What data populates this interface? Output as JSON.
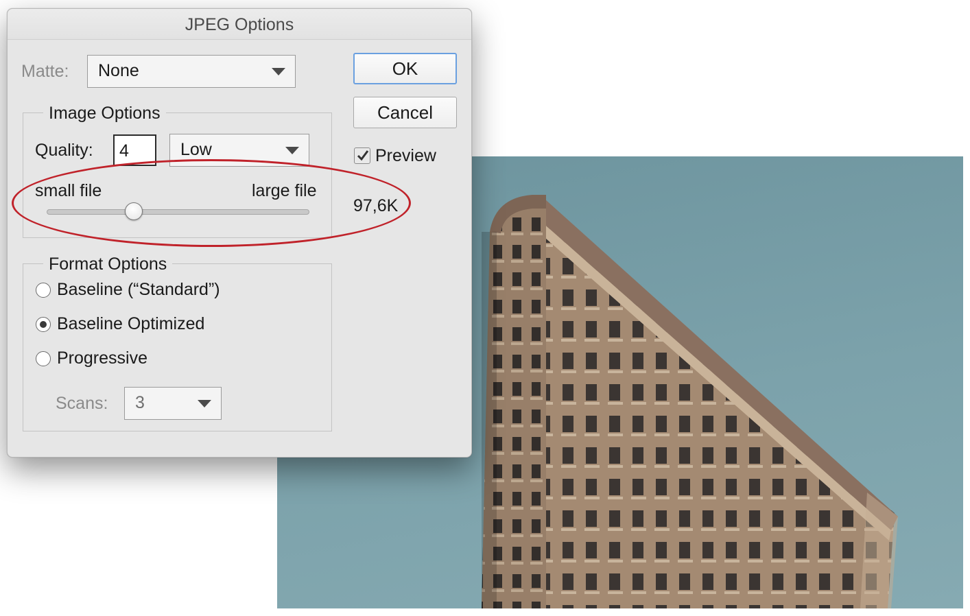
{
  "dialog": {
    "title": "JPEG Options",
    "matte": {
      "label": "Matte:",
      "value": "None"
    },
    "image_options": {
      "legend": "Image Options",
      "quality_label": "Quality:",
      "quality_value": "4",
      "quality_preset": "Low",
      "slider_min_label": "small file",
      "slider_max_label": "large file",
      "slider_level_fraction": 0.33
    },
    "format_options": {
      "legend": "Format Options",
      "options": [
        {
          "label": "Baseline (“Standard”)",
          "selected": false
        },
        {
          "label": "Baseline Optimized",
          "selected": true
        },
        {
          "label": "Progressive",
          "selected": false
        }
      ],
      "scans_label": "Scans:",
      "scans_value": "3"
    },
    "buttons": {
      "ok": "OK",
      "cancel": "Cancel"
    },
    "preview": {
      "label": "Preview",
      "checked": true
    },
    "file_size": "97,6K"
  },
  "colors": {
    "annotation": "#c0222a",
    "default_button_ring": "#6aa0e0",
    "dialog_bg": "#e6e6e6",
    "sky": "#7ca2ab",
    "building": "#a98d74"
  },
  "icons": {
    "dropdown": "chevron-down-icon",
    "checkbox": "checkmark-icon",
    "radio": "radio-button-icon"
  }
}
